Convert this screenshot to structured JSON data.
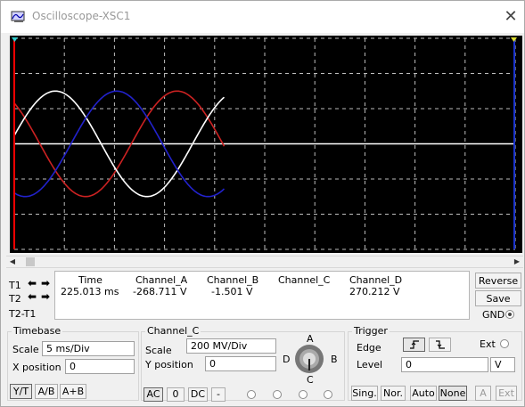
{
  "window": {
    "title": "Oscilloscope-XSC1",
    "close_symbol": "✕"
  },
  "screen": {
    "background": "#000000",
    "grid_color": "#bdbdbd",
    "cursor_t1_color": "#ff0000",
    "cursor_t2_color": "#1a33cc",
    "trace_colors": {
      "channel_a": "#cc2222",
      "channel_b": "#ffffff",
      "channel_c": "#ffffff",
      "channel_d": "#2222cc"
    }
  },
  "cursors": {
    "t1_label": "T1",
    "t2_label": "T2",
    "t2_t1_label": "T2-T1",
    "left_arrow": "⬅",
    "right_arrow": "➡"
  },
  "readout": {
    "headers": [
      "Time",
      "Channel_A",
      "Channel_B",
      "Channel_C",
      "Channel_D"
    ],
    "row1": [
      "225.013 ms",
      "-268.711 V",
      "-1.501 V",
      "",
      "270.212 V"
    ]
  },
  "side_buttons": {
    "reverse": "Reverse",
    "save": "Save",
    "gnd": "GND"
  },
  "timebase": {
    "title": "Timebase",
    "scale_label": "Scale",
    "scale_value": "5 ms/Div",
    "xpos_label": "X position",
    "xpos_value": "0",
    "modes": [
      "Y/T",
      "A/B",
      "A+B"
    ]
  },
  "channel": {
    "title": "Channel_C",
    "scale_label": "Scale",
    "scale_value": "200 MV/Div",
    "ypos_label": "Y position",
    "ypos_value": "0",
    "coupling": [
      "AC",
      "0",
      "DC",
      "-"
    ],
    "knob_labels": {
      "a": "A",
      "b": "B",
      "c": "C",
      "d": "D"
    }
  },
  "trigger": {
    "title": "Trigger",
    "edge_label": "Edge",
    "level_label": "Level",
    "level_value": "0",
    "level_unit": "V",
    "ext_label": "Ext",
    "modes": [
      "Sing.",
      "Nor.",
      "Auto",
      "None"
    ],
    "sources": [
      "A",
      "Ext"
    ]
  }
}
